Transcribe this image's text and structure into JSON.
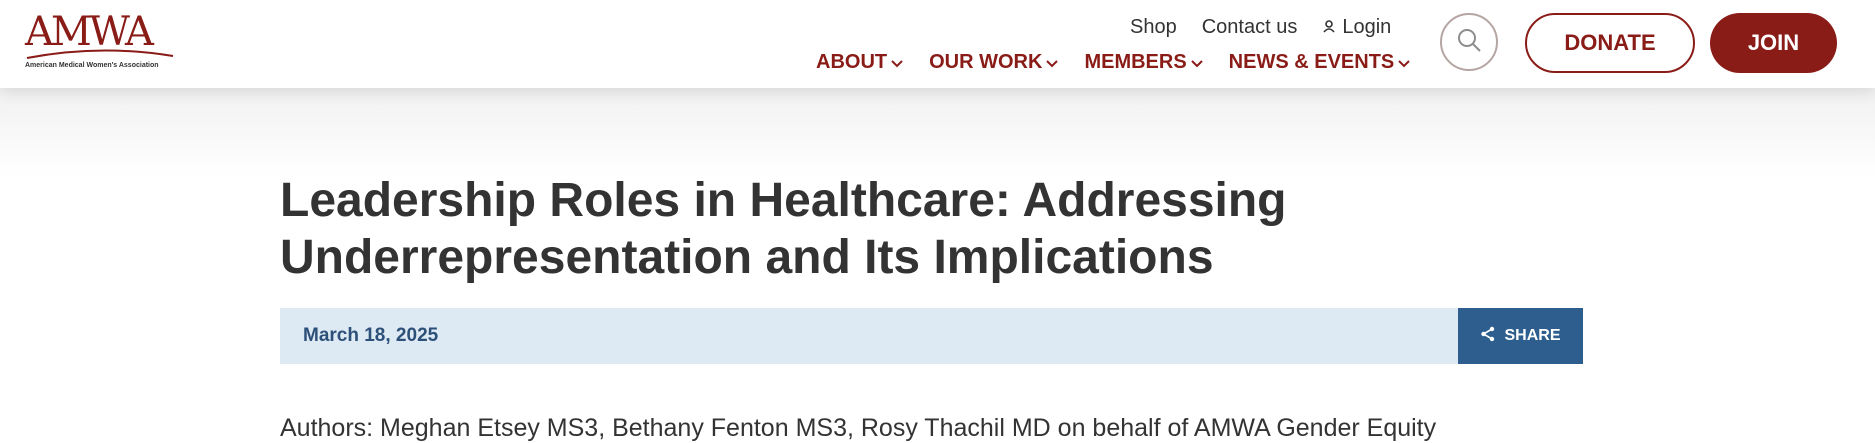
{
  "header": {
    "logo": {
      "mark": "AMWA",
      "subtitle": "American Medical Women's Association"
    },
    "utility_nav": [
      {
        "label": "Shop"
      },
      {
        "label": "Contact us"
      },
      {
        "label": "Login",
        "icon": "user-icon"
      }
    ],
    "main_nav": [
      {
        "label": "ABOUT",
        "icon": "chevron-down-icon"
      },
      {
        "label": "OUR WORK",
        "icon": "chevron-down-icon"
      },
      {
        "label": "MEMBERS",
        "icon": "chevron-down-icon"
      },
      {
        "label": "NEWS & EVENTS",
        "icon": "chevron-down-icon"
      }
    ],
    "search_icon": "search-icon",
    "donate_label": "DONATE",
    "join_label": "JOIN"
  },
  "article": {
    "title": "Leadership Roles in Healthcare: Addressing Underrepresentation and Its Implications",
    "date": "March 18, 2025",
    "share_label": "SHARE",
    "share_icon": "share-icon",
    "authors_line": "Authors:  Meghan Etsey MS3, Bethany Fenton MS3, Rosy Thachil MD on behalf of AMWA Gender Equity"
  },
  "colors": {
    "brand": "#8a1c18",
    "date_bar": "#dde9f3",
    "date_text": "#2d5079",
    "share_button": "#2d5e8e",
    "text": "#333333"
  }
}
